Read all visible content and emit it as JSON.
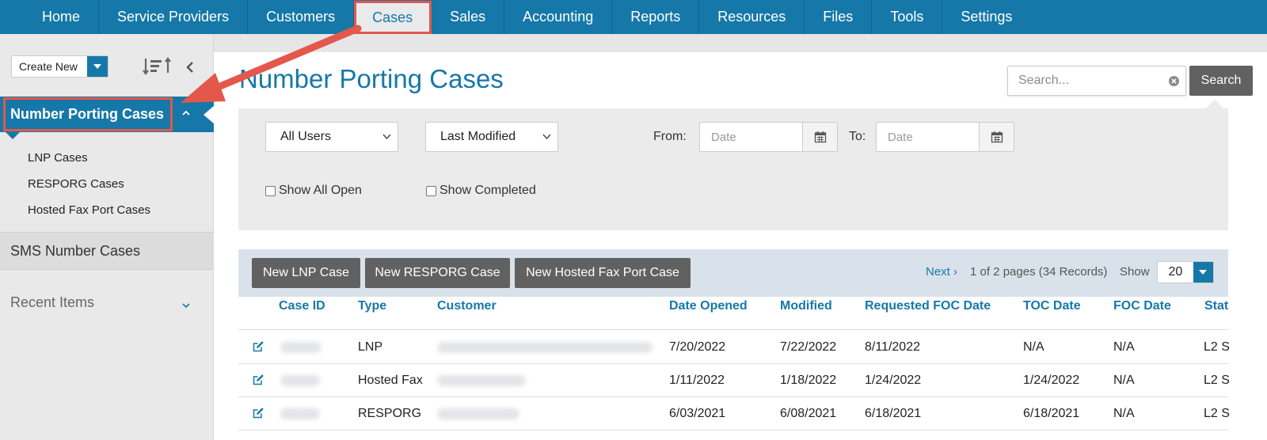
{
  "topnav": {
    "items": [
      "Home",
      "Service Providers",
      "Customers",
      "Cases",
      "Sales",
      "Accounting",
      "Reports",
      "Resources",
      "Files",
      "Tools",
      "Settings"
    ],
    "active_index": 3
  },
  "sidebar": {
    "create_new": "Create New",
    "section_title": "Number Porting Cases",
    "sub_items": [
      "LNP Cases",
      "RESPORG Cases",
      "Hosted Fax Port Cases"
    ],
    "sms_section": "SMS Number Cases",
    "recent_items": "Recent Items"
  },
  "main": {
    "title": "Number Porting Cases",
    "search_placeholder": "Search...",
    "search_button": "Search"
  },
  "filters": {
    "users_select": "All Users",
    "sort_select": "Last Modified",
    "from_label": "From:",
    "to_label": "To:",
    "date_placeholder": "Date",
    "show_all_open": "Show All Open",
    "show_completed": "Show Completed"
  },
  "toolbar": {
    "new_lnp": "New LNP Case",
    "new_resporg": "New RESPORG Case",
    "new_hosted_fax": "New Hosted Fax Port Case",
    "next": "Next ›",
    "pager_info": "1 of 2 pages (34 Records)",
    "show_label": "Show",
    "show_value": "20"
  },
  "table": {
    "headers": [
      "Case ID",
      "Type",
      "Customer",
      "Date Opened",
      "Modified",
      "Requested FOC Date",
      "TOC Date",
      "FOC Date",
      "Stat"
    ],
    "rows": [
      {
        "type": "LNP",
        "date_opened": "7/20/2022",
        "modified": "7/22/2022",
        "requested_foc": "8/11/2022",
        "toc": "N/A",
        "foc": "N/A",
        "status": "L2 S"
      },
      {
        "type": "Hosted Fax",
        "date_opened": "1/11/2022",
        "modified": "1/18/2022",
        "requested_foc": "1/24/2022",
        "toc": "1/24/2022",
        "foc": "N/A",
        "status": "L2 S"
      },
      {
        "type": "RESPORG",
        "date_opened": "6/03/2021",
        "modified": "6/08/2021",
        "requested_foc": "6/18/2021",
        "toc": "6/18/2021",
        "foc": "N/A",
        "status": "L2 S"
      }
    ]
  },
  "colors": {
    "brand_blue": "#1678a8",
    "annotation_red": "#e4574b",
    "button_gray": "#616161"
  }
}
